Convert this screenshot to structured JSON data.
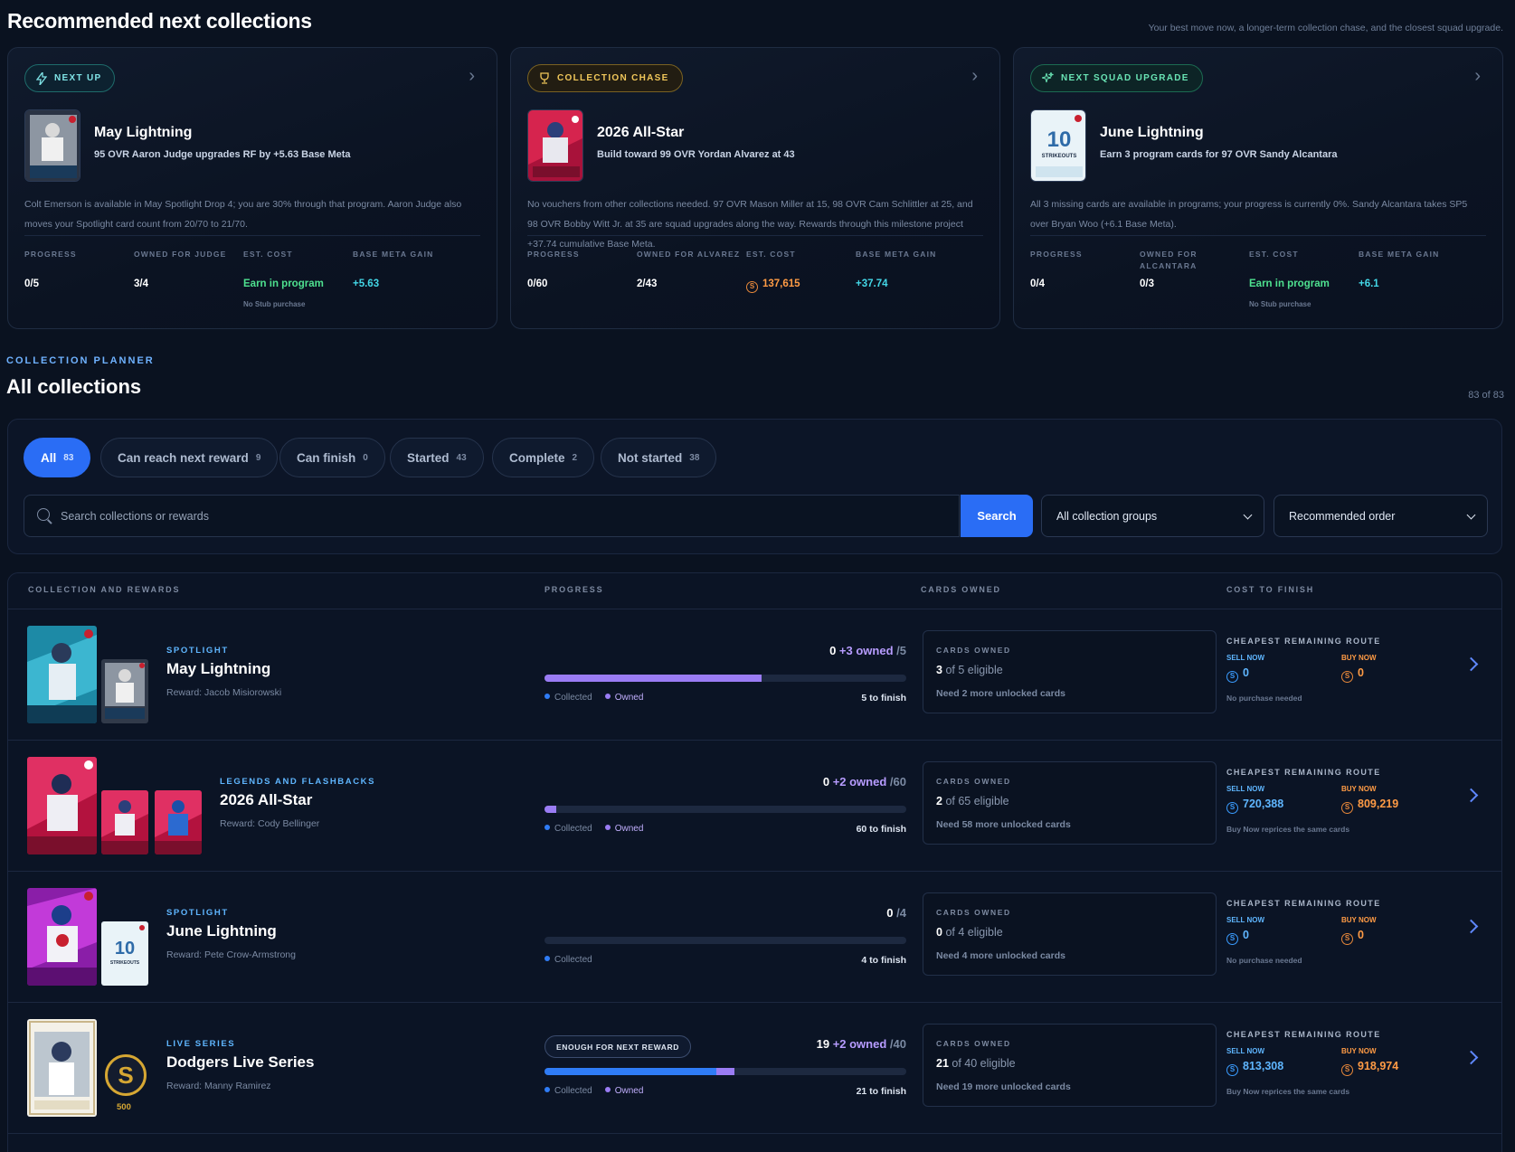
{
  "header": {
    "title": "Recommended next collections",
    "subtitle": "Your best move now, a longer-term collection chase, and the closest squad upgrade."
  },
  "rec_cards": [
    {
      "pill": "NEXT UP",
      "pill_icon": "lightning-icon",
      "name": "May Lightning",
      "sub": "95 OVR Aaron Judge upgrades RF by +5.63 Base Meta",
      "desc": "Colt Emerson is available in May Spotlight Drop 4; you are 30% through that program. Aaron Judge also moves your Spotlight card count from 20/70 to 21/70.",
      "stats": {
        "progress_label": "PROGRESS",
        "progress": "0/5",
        "owned_label": "OWNED FOR JUDGE",
        "owned": "3/4",
        "cost_label": "EST. COST",
        "cost": "Earn in program",
        "cost_note": "No Stub purchase",
        "gain_label": "BASE META GAIN",
        "gain": "+5.63"
      }
    },
    {
      "pill": "COLLECTION CHASE",
      "pill_icon": "trophy-icon",
      "name": "2026 All-Star",
      "sub": "Build toward 99 OVR Yordan Alvarez at 43",
      "desc": "No vouchers from other collections needed. 97 OVR Mason Miller at 15, 98 OVR Cam Schlittler at 25, and 98 OVR Bobby Witt Jr. at 35 are squad upgrades along the way. Rewards through this milestone project +37.74 cumulative Base Meta.",
      "stats": {
        "progress_label": "PROGRESS",
        "progress": "0/60",
        "owned_label": "OWNED FOR ALVAREZ",
        "owned": "2/43",
        "cost_label": "EST. COST",
        "cost": "137,615",
        "cost_note": "",
        "gain_label": "BASE META GAIN",
        "gain": "+37.74"
      }
    },
    {
      "pill": "NEXT SQUAD UPGRADE",
      "pill_icon": "sparkle-icon",
      "name": "June Lightning",
      "sub": "Earn 3 program cards for 97 OVR Sandy Alcantara",
      "desc": "All 3 missing cards are available in programs; your progress is currently 0%. Sandy Alcantara takes SP5 over Bryan Woo (+6.1 Base Meta).",
      "stats": {
        "progress_label": "PROGRESS",
        "progress": "0/4",
        "owned_label": "OWNED FOR ALCANTARA",
        "owned": "0/3",
        "cost_label": "EST. COST",
        "cost": "Earn in program",
        "cost_note": "No Stub purchase",
        "gain_label": "BASE META GAIN",
        "gain": "+6.1"
      }
    }
  ],
  "planner": {
    "eyebrow": "COLLECTION PLANNER",
    "title": "All collections",
    "count": "83 of 83"
  },
  "filters": [
    {
      "label": "All",
      "count": "83"
    },
    {
      "label": "Can reach next reward",
      "count": "9"
    },
    {
      "label": "Can finish",
      "count": "0"
    },
    {
      "label": "Started",
      "count": "43"
    },
    {
      "label": "Complete",
      "count": "2"
    },
    {
      "label": "Not started",
      "count": "38"
    }
  ],
  "search": {
    "placeholder": "Search collections or rewards",
    "button": "Search",
    "group_select": "All collection groups",
    "order_select": "Recommended order"
  },
  "table": {
    "headers": [
      "COLLECTION AND REWARDS",
      "PROGRESS",
      "CARDS OWNED",
      "COST TO FINISH"
    ],
    "legend_collected": "Collected",
    "legend_owned": "Owned",
    "owned_box_label": "CARDS OWNED",
    "cost_label": "CHEAPEST REMAINING ROUTE",
    "sell_label": "SELL NOW",
    "buy_label": "BUY NOW",
    "rows": [
      {
        "eyebrow": "SPOTLIGHT",
        "name": "May Lightning",
        "reward": "Reward: Jacob Misiorowski",
        "collected": "0",
        "owned_extra": "+3 owned",
        "total": "/5",
        "collected_frac": 0.0,
        "owned_frac": 0.6,
        "to_finish": "5 to finish",
        "badge": "",
        "owned_count": "3",
        "owned_of": "of 5 eligible",
        "need": "Need 2 more unlocked cards",
        "sell": "0",
        "buy": "0",
        "cost_note": "No purchase needed"
      },
      {
        "eyebrow": "LEGENDS AND FLASHBACKS",
        "name": "2026 All-Star",
        "reward": "Reward: Cody Bellinger",
        "collected": "0",
        "owned_extra": "+2 owned",
        "total": "/60",
        "collected_frac": 0.0,
        "owned_frac": 0.033,
        "to_finish": "60 to finish",
        "badge": "",
        "owned_count": "2",
        "owned_of": "of 65 eligible",
        "need": "Need 58 more unlocked cards",
        "sell": "720,388",
        "buy": "809,219",
        "cost_note": "Buy Now reprices the same cards"
      },
      {
        "eyebrow": "SPOTLIGHT",
        "name": "June Lightning",
        "reward": "Reward: Pete Crow-Armstrong",
        "collected": "0",
        "owned_extra": "",
        "total": "/4",
        "collected_frac": 0.0,
        "owned_frac": 0.0,
        "to_finish": "4 to finish",
        "badge": "",
        "owned_count": "0",
        "owned_of": "of 4 eligible",
        "need": "Need 4 more unlocked cards",
        "sell": "0",
        "buy": "0",
        "cost_note": "No purchase needed"
      },
      {
        "eyebrow": "LIVE SERIES",
        "name": "Dodgers Live Series",
        "reward": "Reward: Manny Ramirez",
        "collected": "19",
        "owned_extra": "+2 owned",
        "total": "/40",
        "collected_frac": 0.475,
        "owned_frac": 0.05,
        "to_finish": "21 to finish",
        "badge": "ENOUGH FOR NEXT REWARD",
        "owned_count": "21",
        "owned_of": "of 40 eligible",
        "need": "Need 19 more unlocked cards",
        "sell": "813,308",
        "buy": "918,974",
        "cost_note": "Buy Now reprices the same cards",
        "stub_reward": "500"
      }
    ]
  },
  "colors": {
    "accent": "#2a6df5",
    "collected": "#2f7cf6",
    "owned": "#9a7cf4",
    "sell": "#5fb6ff",
    "buy": "#ff9b45",
    "earn": "#4ee08f",
    "gain": "#43d6e6"
  }
}
